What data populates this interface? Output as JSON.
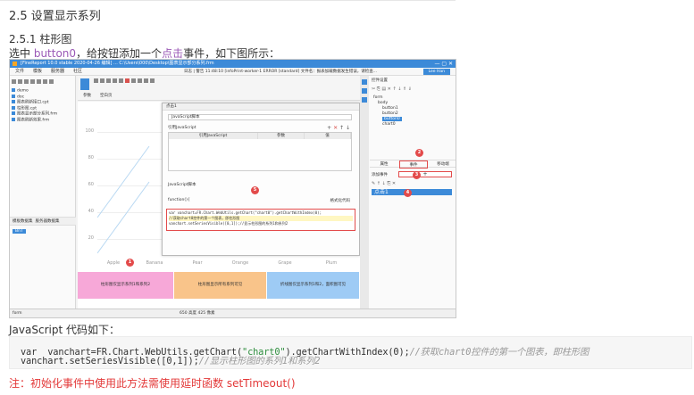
{
  "section_title": "2.5 设置显示系列",
  "subsection_title": "2.5.1 柱形图",
  "intro": {
    "prefix": "选中 ",
    "button_name": "button0",
    "middle": "，给按钮添加一个",
    "event_name": "点击",
    "suffix": "事件，如下图所示："
  },
  "screenshot": {
    "window_title": "[FineReport 10.0 stable 2020-04-26 编辑] ...  C:\\Users\\000\\Desktop\\图表显示部分系列.frm",
    "menu": [
      "文件",
      "模板",
      "服务器",
      "社区"
    ],
    "status_bar_text": "日志 | 警告 11:48:10 [infoPrint-worker-1 ERROR [standard] 文件名：报表加载数据发生错误，请检查...",
    "user": "Lee Han",
    "left_tree": [
      "demo",
      "doc",
      "图表刷新接口.cpt",
      "柱形图.cpt",
      "图表显示部分系列.frm",
      "图表刷新效果.frm"
    ],
    "left_tabs": [
      "模板数据集",
      "服务器数据集"
    ],
    "left_item": "BnT",
    "center_tabs": [
      "参数",
      "空白页"
    ],
    "dialog": {
      "title": "点击1",
      "select": "JavaScript脚本",
      "params_label": "引用JavaScript",
      "table_headers": [
        "引用JavaScript",
        "参数",
        "值"
      ],
      "script_label": "JavaScript脚本",
      "function_label": "function(){",
      "format_label": "格式化代码",
      "code_lines": [
        "var vanchart=FR.Chart.WebUtils.getChart(\"chart0\").getChartWithIndex(0);",
        "//获取chart0控件的第一个图表，即柱形图",
        "vanchart.setSeriesVisible([0,1]);//显示柱形图的系列1和系列2"
      ]
    },
    "y_ticks": [
      "100",
      "80",
      "60",
      "40",
      "20"
    ],
    "x_labels": [
      "Apple",
      "Banana",
      "Pear",
      "Orange",
      "Grape",
      "Plum"
    ],
    "bands": [
      "柱形图仅显示系列1和系列2",
      "柱形图显示所有系列可见",
      "折线图仅显示系列1和2，面积图可见"
    ],
    "right_panel": {
      "title": "控件设置",
      "tree": [
        "form",
        "body",
        "button1",
        "button2",
        "button0",
        "chart0"
      ],
      "tabs": [
        "属性",
        "事件",
        "移动端"
      ],
      "event_label": "添加事件",
      "event_select": "+",
      "event_item": "点击1"
    },
    "footer": {
      "left": "form",
      "zoom": "650",
      "height_label": "高度",
      "height": "425",
      "unit": "像素"
    },
    "badges": [
      "1",
      "2",
      "3",
      "4",
      "5"
    ]
  },
  "code_caption": "JavaScript 代码如下：",
  "code": {
    "line1_a": "var  vanchart=FR.Chart.WebUtils.getChart(",
    "line1_str": "\"chart0\"",
    "line1_b": ").getChartWithIndex(0);",
    "line1_comment": "//获取chart0控件的第一个图表，即柱形图",
    "line2_a": "vanchart.setSeriesVisible([0,1]);",
    "line2_comment": "//显示柱形图的系列1和系列2"
  },
  "note": "注：初始化事件中使用此方法需使用延时函数 setTimeout()"
}
